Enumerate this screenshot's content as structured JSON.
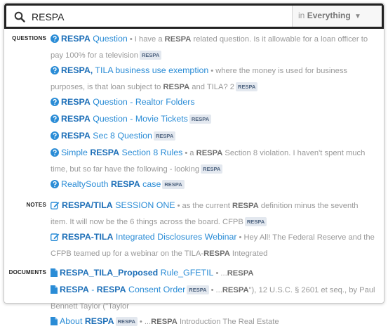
{
  "search": {
    "query": "RESPA",
    "scope_prefix": "in",
    "scope_value": "Everything",
    "scope_caret": "▼"
  },
  "icons": {
    "search": "search-icon",
    "question": "question-circle-icon",
    "note": "pencil-square-icon",
    "document": "document-icon"
  },
  "colors": {
    "link": "#2a8cd6",
    "tag_bg": "#e3e8ef",
    "tag_text": "#4f6480",
    "border_dark": "#222222"
  },
  "sections": [
    {
      "label": "QUESTIONS",
      "items": [
        {
          "hl": "RESPA",
          "rest": " Question",
          "snippet": [
            [
              "I have a ",
              ""
            ],
            [
              "RESPA",
              "b"
            ],
            [
              " related question.  Is it allowable for a loan officer to pay 100% for a television",
              ""
            ]
          ],
          "tag": "RESPA"
        },
        {
          "hl": "RESPA,",
          "rest": " TILA business use exemption",
          "snippet": [
            [
              "where the money is used for business purposes, is that loan subject to ",
              ""
            ],
            [
              "RESPA",
              "b"
            ],
            [
              " and TILA? 2",
              ""
            ]
          ],
          "tag": "RESPA"
        },
        {
          "hl": "RESPA",
          "rest": " Question - Realtor Folders",
          "snippet": [],
          "tag": ""
        },
        {
          "hl": "RESPA",
          "rest": " Question - Movie Tickets",
          "snippet": [],
          "tag": "RESPA"
        },
        {
          "hl": "RESPA",
          "rest": " Sec 8 Question",
          "snippet": [],
          "tag": "RESPA"
        },
        {
          "pre": "Simple ",
          "hl": "RESPA",
          "rest": " Section 8 Rules",
          "snippet": [
            [
              "a ",
              ""
            ],
            [
              "RESPA",
              "b"
            ],
            [
              " Section 8 violation. I haven't spent much time, but so far have the following - looking",
              ""
            ]
          ],
          "tag": "RESPA"
        },
        {
          "pre": "RealtySouth ",
          "hl": "RESPA",
          "rest": " case",
          "snippet": [],
          "tag": "RESPA"
        }
      ]
    },
    {
      "label": "NOTES",
      "items": [
        {
          "hl": "RESPA/TILA",
          "rest": " SESSION ONE",
          "snippet": [
            [
              "as the current ",
              ""
            ],
            [
              "RESPA",
              "b"
            ],
            [
              " definition minus the seventh item. It will now be the 6 things across the board.  CFPB",
              ""
            ]
          ],
          "tag": "RESPA"
        },
        {
          "hl": "RESPA-TILA",
          "rest": " Integrated Disclosures Webinar",
          "snippet": [
            [
              "Hey All! The Federal Reserve and the CFPB teamed up for a webinar on the TILA-",
              ""
            ],
            [
              "RESPA",
              "b"
            ],
            [
              " Integrated",
              ""
            ]
          ],
          "tag": ""
        }
      ]
    },
    {
      "label": "DOCUMENTS",
      "items": [
        {
          "hl": "RESPA_TILA_Proposed",
          "rest": " Rule_GFETIL",
          "snippet": [
            [
              "...",
              ""
            ],
            [
              "RESPA",
              "b"
            ]
          ],
          "tag": ""
        },
        {
          "hl": "RESPA",
          "rest": " - ",
          "hl2": "RESPA",
          "rest2": " Consent Order",
          "tag_before": "RESPA",
          "snippet": [
            [
              "...",
              ""
            ],
            [
              "RESPA",
              "b"
            ],
            [
              "\"), 12 U.S.C. § 2601 et seq., by Paul Bennett Taylor (\"Taylor",
              ""
            ]
          ],
          "tag": ""
        },
        {
          "pre": "About ",
          "hl": "RESPA",
          "rest": "",
          "tag_before": "RESPA",
          "snippet": [
            [
              "...",
              ""
            ],
            [
              "RESPA",
              "b"
            ],
            [
              " Introduction The Real Estate",
              ""
            ]
          ],
          "tag": ""
        }
      ]
    }
  ]
}
